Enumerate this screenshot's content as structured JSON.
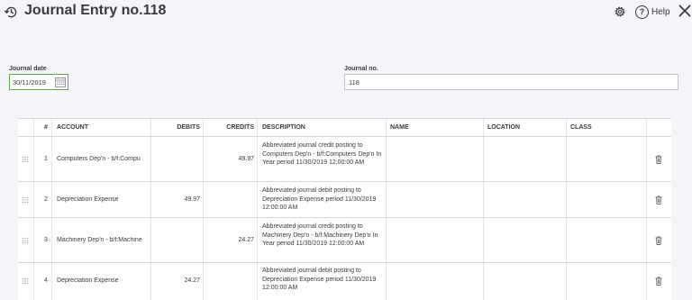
{
  "header": {
    "title": "Journal Entry no.118",
    "help_label": "Help"
  },
  "form": {
    "journal_date_label": "Journal date",
    "journal_date_value": "30/11/2019",
    "journal_no_label": "Journal no.",
    "journal_no_value": "118"
  },
  "table": {
    "columns": {
      "num": "#",
      "account": "ACCOUNT",
      "debits": "DEBITS",
      "credits": "CREDITS",
      "description": "DESCRIPTION",
      "name": "NAME",
      "location": "LOCATION",
      "class": "CLASS"
    },
    "rows": [
      {
        "num": "1",
        "account": "Computers Dep'n - b/f:Compu",
        "debits": "",
        "credits": "49.97",
        "description": "Abbreviated journal credit posting to Computers Dep'n - b/f:Computers Dep'n In Year period 11/30/2019 12:00:00 AM"
      },
      {
        "num": "2",
        "account": "Depreciation Expense",
        "debits": "49.97",
        "credits": "",
        "description": "Abbreviated journal debit posting to Depreciation Expense period 11/30/2019 12:00:00 AM"
      },
      {
        "num": "3",
        "account": "Machinery Dep'n - b/f:Machine",
        "debits": "",
        "credits": "24.27",
        "description": "Abbreviated journal credit posting to Machinery Dep'n - b/f:Machinery Dep'n In Year period 11/30/2019 12:00:00 AM"
      },
      {
        "num": "4",
        "account": "Depreciation Expense",
        "debits": "24.27",
        "credits": "",
        "description": "Abbreviated journal debit posting to Depreciation Expense period 11/30/2019 12:00:00 AM"
      }
    ]
  },
  "colors": {
    "accent_green": "#5fa850",
    "text": "#393a3d",
    "border": "#d4d7dc",
    "background": "#f4f5f8"
  }
}
